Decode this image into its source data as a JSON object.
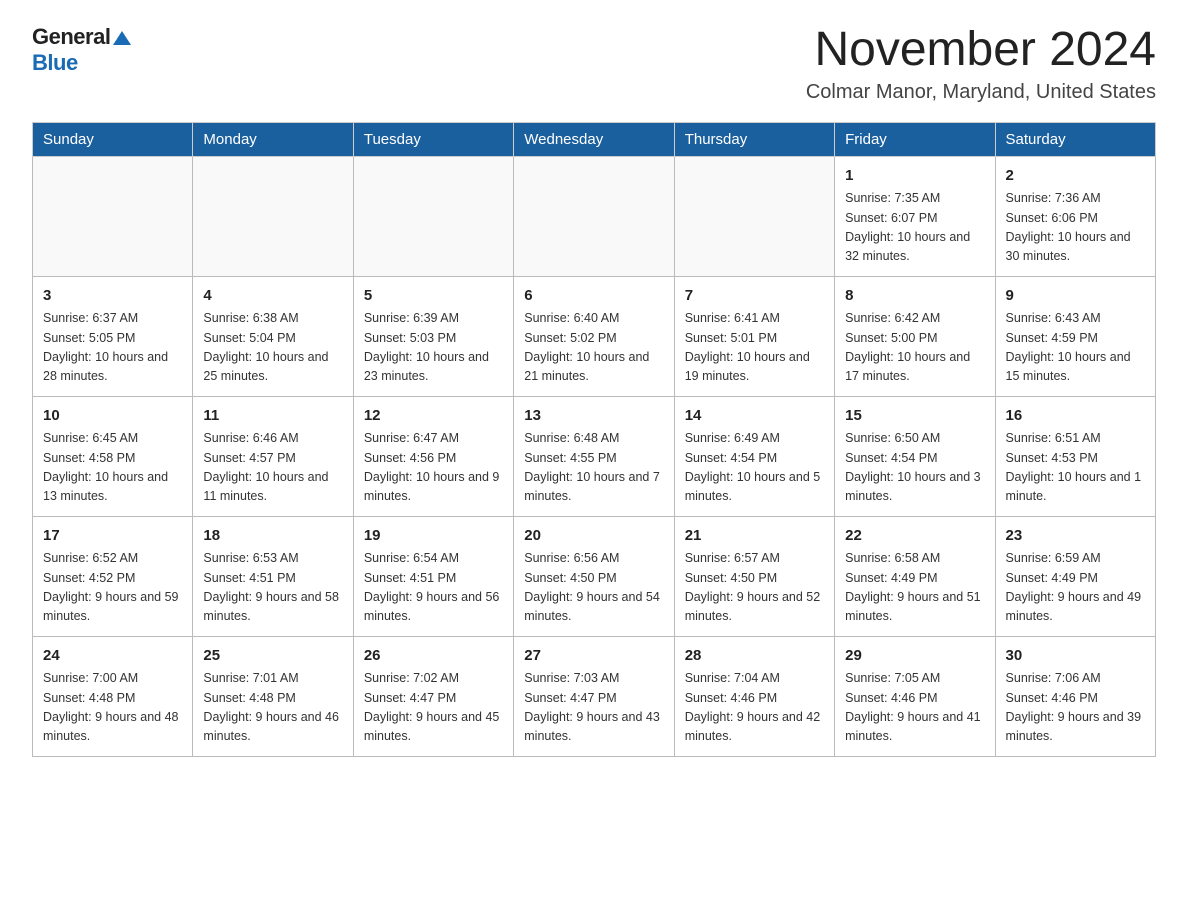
{
  "logo": {
    "general": "General",
    "triangle": "▶",
    "blue": "Blue"
  },
  "title": "November 2024",
  "subtitle": "Colmar Manor, Maryland, United States",
  "weekdays": [
    "Sunday",
    "Monday",
    "Tuesday",
    "Wednesday",
    "Thursday",
    "Friday",
    "Saturday"
  ],
  "weeks": [
    [
      {
        "day": "",
        "info": ""
      },
      {
        "day": "",
        "info": ""
      },
      {
        "day": "",
        "info": ""
      },
      {
        "day": "",
        "info": ""
      },
      {
        "day": "",
        "info": ""
      },
      {
        "day": "1",
        "info": "Sunrise: 7:35 AM\nSunset: 6:07 PM\nDaylight: 10 hours and 32 minutes."
      },
      {
        "day": "2",
        "info": "Sunrise: 7:36 AM\nSunset: 6:06 PM\nDaylight: 10 hours and 30 minutes."
      }
    ],
    [
      {
        "day": "3",
        "info": "Sunrise: 6:37 AM\nSunset: 5:05 PM\nDaylight: 10 hours and 28 minutes."
      },
      {
        "day": "4",
        "info": "Sunrise: 6:38 AM\nSunset: 5:04 PM\nDaylight: 10 hours and 25 minutes."
      },
      {
        "day": "5",
        "info": "Sunrise: 6:39 AM\nSunset: 5:03 PM\nDaylight: 10 hours and 23 minutes."
      },
      {
        "day": "6",
        "info": "Sunrise: 6:40 AM\nSunset: 5:02 PM\nDaylight: 10 hours and 21 minutes."
      },
      {
        "day": "7",
        "info": "Sunrise: 6:41 AM\nSunset: 5:01 PM\nDaylight: 10 hours and 19 minutes."
      },
      {
        "day": "8",
        "info": "Sunrise: 6:42 AM\nSunset: 5:00 PM\nDaylight: 10 hours and 17 minutes."
      },
      {
        "day": "9",
        "info": "Sunrise: 6:43 AM\nSunset: 4:59 PM\nDaylight: 10 hours and 15 minutes."
      }
    ],
    [
      {
        "day": "10",
        "info": "Sunrise: 6:45 AM\nSunset: 4:58 PM\nDaylight: 10 hours and 13 minutes."
      },
      {
        "day": "11",
        "info": "Sunrise: 6:46 AM\nSunset: 4:57 PM\nDaylight: 10 hours and 11 minutes."
      },
      {
        "day": "12",
        "info": "Sunrise: 6:47 AM\nSunset: 4:56 PM\nDaylight: 10 hours and 9 minutes."
      },
      {
        "day": "13",
        "info": "Sunrise: 6:48 AM\nSunset: 4:55 PM\nDaylight: 10 hours and 7 minutes."
      },
      {
        "day": "14",
        "info": "Sunrise: 6:49 AM\nSunset: 4:54 PM\nDaylight: 10 hours and 5 minutes."
      },
      {
        "day": "15",
        "info": "Sunrise: 6:50 AM\nSunset: 4:54 PM\nDaylight: 10 hours and 3 minutes."
      },
      {
        "day": "16",
        "info": "Sunrise: 6:51 AM\nSunset: 4:53 PM\nDaylight: 10 hours and 1 minute."
      }
    ],
    [
      {
        "day": "17",
        "info": "Sunrise: 6:52 AM\nSunset: 4:52 PM\nDaylight: 9 hours and 59 minutes."
      },
      {
        "day": "18",
        "info": "Sunrise: 6:53 AM\nSunset: 4:51 PM\nDaylight: 9 hours and 58 minutes."
      },
      {
        "day": "19",
        "info": "Sunrise: 6:54 AM\nSunset: 4:51 PM\nDaylight: 9 hours and 56 minutes."
      },
      {
        "day": "20",
        "info": "Sunrise: 6:56 AM\nSunset: 4:50 PM\nDaylight: 9 hours and 54 minutes."
      },
      {
        "day": "21",
        "info": "Sunrise: 6:57 AM\nSunset: 4:50 PM\nDaylight: 9 hours and 52 minutes."
      },
      {
        "day": "22",
        "info": "Sunrise: 6:58 AM\nSunset: 4:49 PM\nDaylight: 9 hours and 51 minutes."
      },
      {
        "day": "23",
        "info": "Sunrise: 6:59 AM\nSunset: 4:49 PM\nDaylight: 9 hours and 49 minutes."
      }
    ],
    [
      {
        "day": "24",
        "info": "Sunrise: 7:00 AM\nSunset: 4:48 PM\nDaylight: 9 hours and 48 minutes."
      },
      {
        "day": "25",
        "info": "Sunrise: 7:01 AM\nSunset: 4:48 PM\nDaylight: 9 hours and 46 minutes."
      },
      {
        "day": "26",
        "info": "Sunrise: 7:02 AM\nSunset: 4:47 PM\nDaylight: 9 hours and 45 minutes."
      },
      {
        "day": "27",
        "info": "Sunrise: 7:03 AM\nSunset: 4:47 PM\nDaylight: 9 hours and 43 minutes."
      },
      {
        "day": "28",
        "info": "Sunrise: 7:04 AM\nSunset: 4:46 PM\nDaylight: 9 hours and 42 minutes."
      },
      {
        "day": "29",
        "info": "Sunrise: 7:05 AM\nSunset: 4:46 PM\nDaylight: 9 hours and 41 minutes."
      },
      {
        "day": "30",
        "info": "Sunrise: 7:06 AM\nSunset: 4:46 PM\nDaylight: 9 hours and 39 minutes."
      }
    ]
  ]
}
